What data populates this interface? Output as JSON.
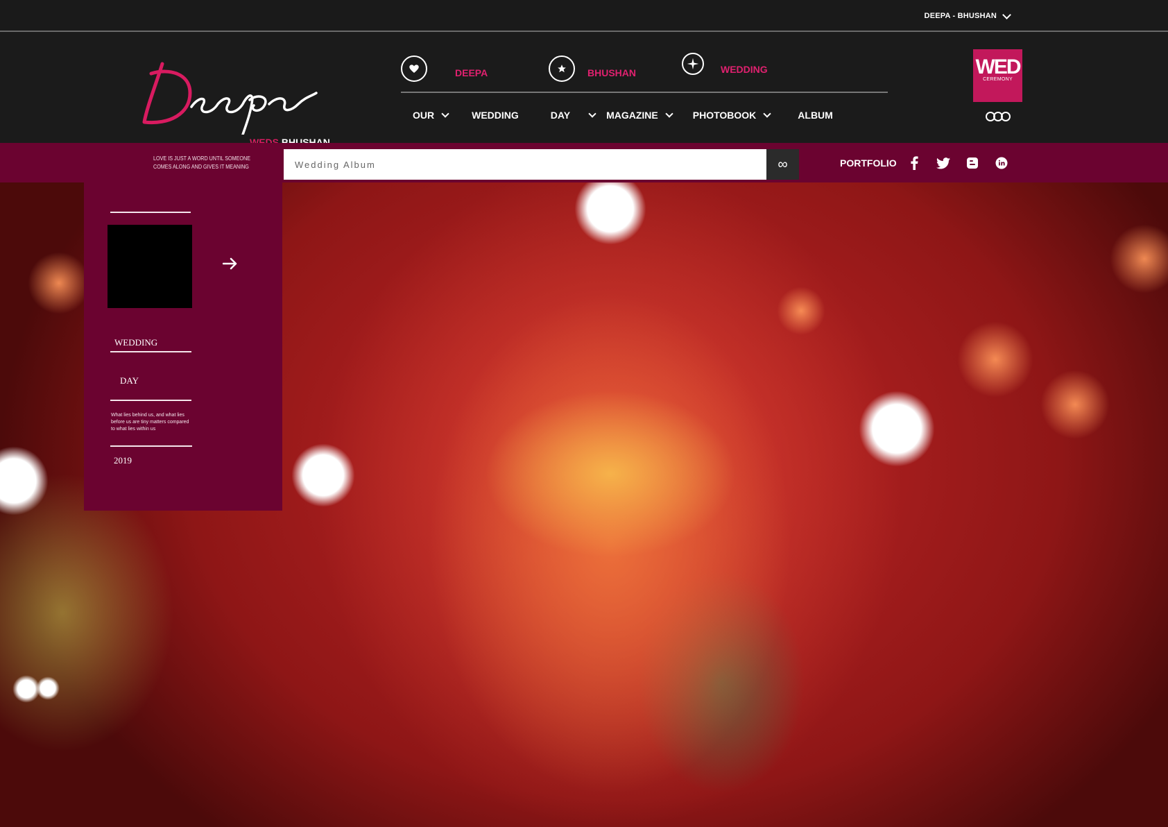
{
  "topbar": {
    "user_label": "DEEPA - BHUSHAN"
  },
  "logo": {
    "script_text": "Deepa",
    "weds": "WEDS",
    "groom": "BHUSHAN"
  },
  "couple": [
    {
      "label": "DEEPA",
      "icon": "heart-icon"
    },
    {
      "label": "BHUSHAN",
      "icon": "star-icon"
    },
    {
      "label": "WEDDING",
      "icon": "compass-star-icon"
    }
  ],
  "nav": {
    "our": "OUR",
    "wedding": "WEDDING",
    "day": "DAY",
    "magazine": "MAGAZINE",
    "photobook": "PHOTOBOOK",
    "album": "ALBUM"
  },
  "badge": {
    "big": "WED",
    "small": "CEREMONY"
  },
  "strip": {
    "quote_line1": "LOVE IS JUST A WORD UNTIL SOMEONE",
    "quote_line2": "COMES ALONG AND GIVES IT MEANING",
    "search_placeholder": "Wedding Album",
    "search_icon": "∞",
    "portfolio": "PORTFOLIO"
  },
  "social": [
    "facebook-icon",
    "twitter-icon",
    "blogger-icon",
    "linkedin-icon"
  ],
  "panel": {
    "wedding": "WEDDING",
    "day": "DAY",
    "quote": "What lies behind us, and what lies before us are tiny matters compared to what lies within us",
    "year": "2019"
  },
  "colors": {
    "accent": "#e0216f",
    "maroon": "#6b0330",
    "badge": "#c2185b",
    "dark": "#1b1b1b"
  }
}
